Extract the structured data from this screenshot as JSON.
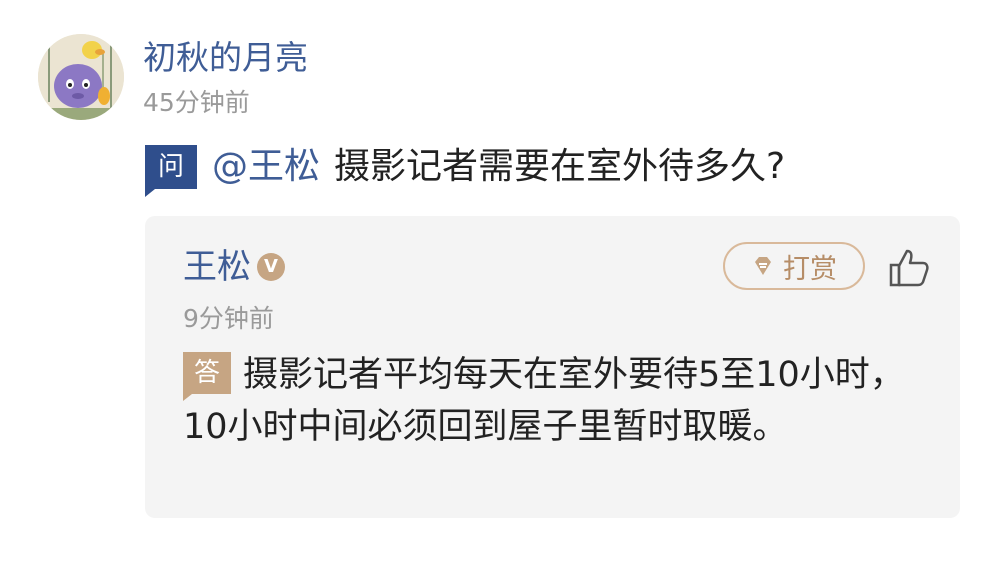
{
  "post": {
    "author_name": "初秋的月亮",
    "time": "45分钟前",
    "question_badge": "问",
    "mention": "@王松",
    "question_text": "摄影记者需要在室外待多久?"
  },
  "answer": {
    "author_name": "王松",
    "verified_badge": "V",
    "tip_label": "打赏",
    "time": "9分钟前",
    "answer_badge": "答",
    "text": "摄影记者平均每天在室外要待5至10小时，10小时中间必须回到屋子里暂时取暖。"
  },
  "icons": {
    "avatar": "cartoon-avatar",
    "verified": "verified-badge-icon",
    "tip": "gem-icon",
    "like": "thumbs-up-icon"
  },
  "colors": {
    "link_blue": "#3f5d96",
    "question_badge_bg": "#2f4e8c",
    "answer_badge_bg": "#c6a583",
    "tip_border": "#d9b99a",
    "card_bg": "#f4f4f4",
    "muted_text": "#9a9a9a"
  }
}
